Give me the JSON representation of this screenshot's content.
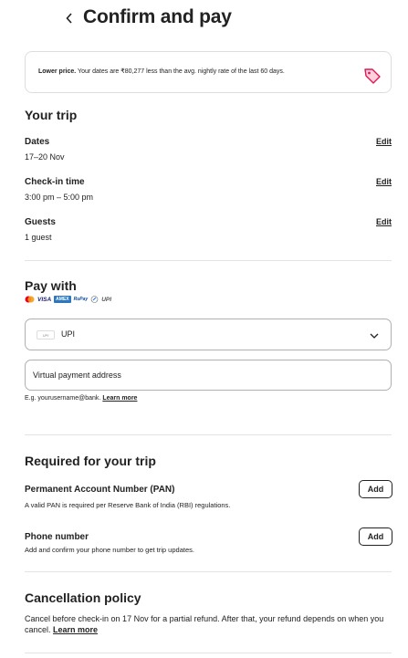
{
  "header": {
    "title": "Confirm and pay"
  },
  "notice": {
    "bold": "Lower price.",
    "text": " Your dates are ₹80,277 less than the avg. nightly rate of the last 60 days."
  },
  "trip": {
    "heading": "Your trip",
    "edit_label": "Edit",
    "dates_label": "Dates",
    "dates_value": "17–20 Nov",
    "checkin_label": "Check-in time",
    "checkin_value": "3:00 pm – 5:00 pm",
    "guests_label": "Guests",
    "guests_value": "1 guest"
  },
  "pay": {
    "heading": "Pay with",
    "cards": [
      "VISA",
      "AMEX",
      "RuPay",
      "UPI"
    ],
    "method_mini": "UPI",
    "method_selected": "UPI",
    "vpa_placeholder": "Virtual payment address",
    "hint": "E.g. yourusername@bank.",
    "hint_link": "Learn more"
  },
  "required": {
    "heading": "Required for your trip",
    "pan_label": "Permanent Account Number (PAN)",
    "pan_desc": "A valid PAN is required per Reserve Bank of India (RBI) regulations.",
    "phone_label": "Phone number",
    "phone_desc": "Add and confirm your phone number to get trip updates.",
    "add_label": "Add"
  },
  "cancellation": {
    "heading": "Cancellation policy",
    "text": "Cancel before check-in on 17 Nov for a partial refund. After that, your refund depends on when you cancel.",
    "link": "Learn more"
  },
  "colors": {
    "text": "#222222",
    "accent": "#ff385c",
    "divider": "#e4e4e4"
  }
}
